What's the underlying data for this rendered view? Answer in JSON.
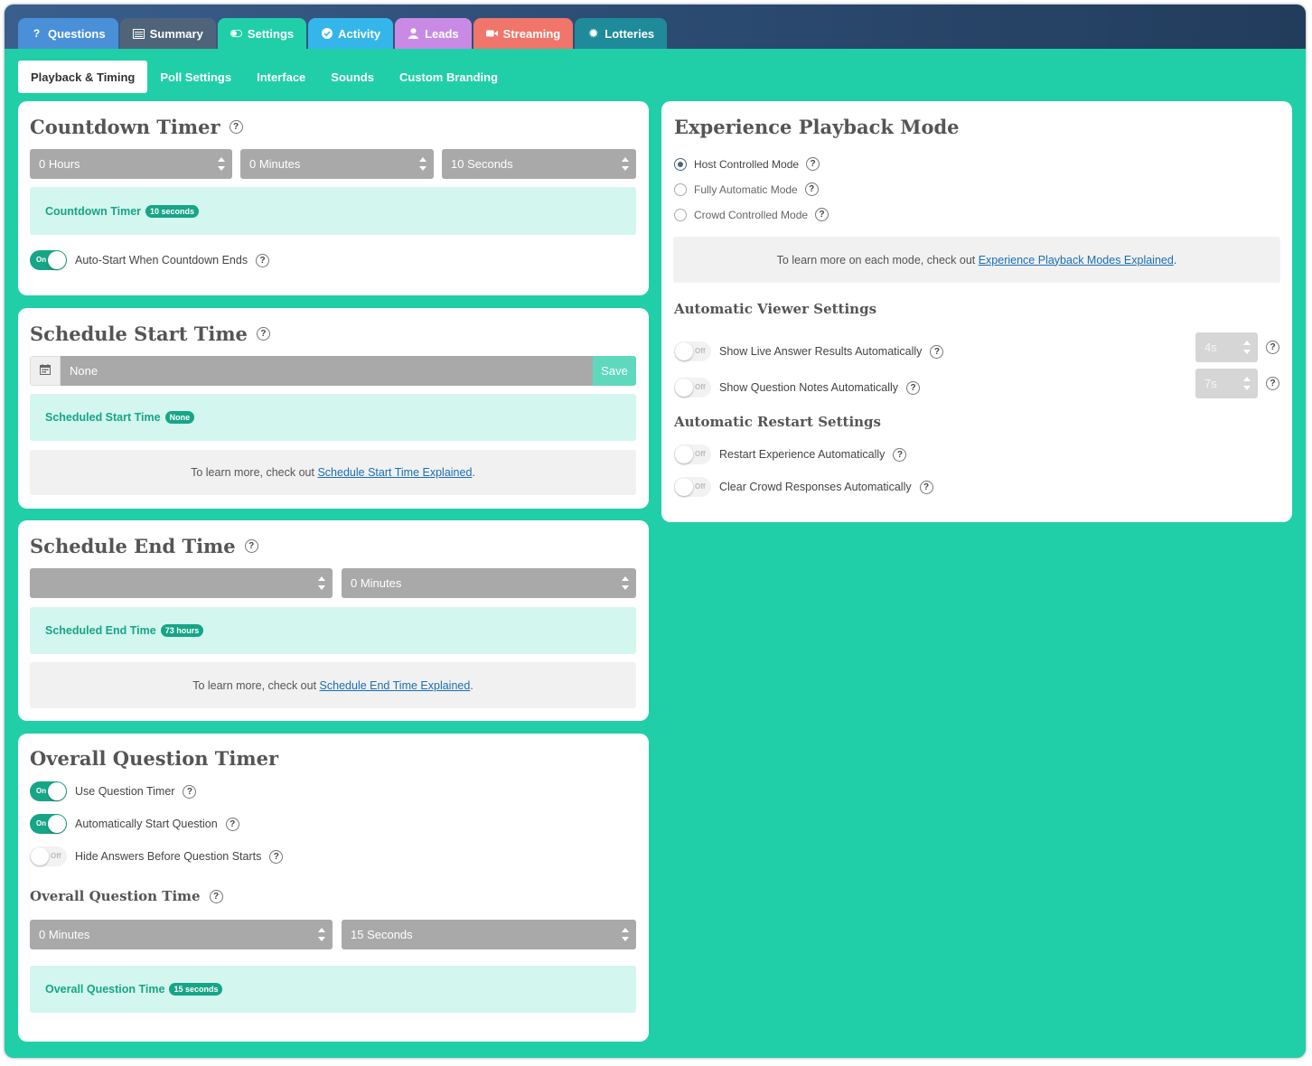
{
  "tabs": [
    {
      "label": "Questions",
      "icon": "question-icon",
      "color": "#4a90d9"
    },
    {
      "label": "Summary",
      "icon": "list-icon",
      "color": "#4f6479"
    },
    {
      "label": "Settings",
      "icon": "toggle-icon",
      "color": "#20cfa8"
    },
    {
      "label": "Activity",
      "icon": "check-circle-icon",
      "color": "#35b6ea"
    },
    {
      "label": "Leads",
      "icon": "user-icon",
      "color": "#c98ae6"
    },
    {
      "label": "Streaming",
      "icon": "video-icon",
      "color": "#f0756a"
    },
    {
      "label": "Lotteries",
      "icon": "gear-icon",
      "color": "#1f8b9a"
    }
  ],
  "subnav": [
    "Playback & Timing",
    "Poll Settings",
    "Interface",
    "Sounds",
    "Custom Branding"
  ],
  "countdown": {
    "title": "Countdown Timer",
    "hours": "0 Hours",
    "minutes": "0 Minutes",
    "seconds": "10 Seconds",
    "summary_label": "Countdown Timer",
    "summary_value": "10 seconds",
    "autostart_label": "Auto-Start When Countdown Ends",
    "autostart_state": "On"
  },
  "schedule_start": {
    "title": "Schedule Start Time",
    "date_value": "None",
    "save_label": "Save",
    "summary_label": "Scheduled Start Time",
    "summary_value": "None",
    "info_prefix": "To learn more, check out ",
    "info_link": "Schedule Start Time Explained",
    "info_suffix": "."
  },
  "schedule_end": {
    "title": "Schedule End Time",
    "hours": "",
    "minutes": "0 Minutes",
    "summary_label": "Scheduled End Time",
    "summary_value": "73 hours",
    "info_prefix": "To learn more, check out ",
    "info_link": "Schedule End Time Explained",
    "info_suffix": "."
  },
  "question_timer": {
    "title": "Overall Question Timer",
    "toggles": [
      {
        "label": "Use Question Timer",
        "state": "On"
      },
      {
        "label": "Automatically Start Question",
        "state": "On"
      },
      {
        "label": "Hide Answers Before Question Starts",
        "state": "Off"
      }
    ],
    "time_title": "Overall Question Time",
    "minutes": "0 Minutes",
    "seconds": "15 Seconds",
    "summary_label": "Overall Question Time",
    "summary_value": "15 seconds"
  },
  "playback": {
    "title": "Experience Playback Mode",
    "modes": [
      {
        "label": "Host Controlled Mode",
        "checked": true
      },
      {
        "label": "Fully Automatic Mode",
        "checked": false
      },
      {
        "label": "Crowd Controlled Mode",
        "checked": false
      }
    ],
    "info_prefix": "To learn more on each mode, check out ",
    "info_link": "Experience Playback Modes Explained",
    "info_suffix": ".",
    "viewer_title": "Automatic Viewer Settings",
    "viewer": [
      {
        "label": "Show Live Answer Results Automatically",
        "state": "Off",
        "select": "4s"
      },
      {
        "label": "Show Question Notes Automatically",
        "state": "Off",
        "select": "7s"
      }
    ],
    "restart_title": "Automatic Restart Settings",
    "restart": [
      {
        "label": "Restart Experience Automatically",
        "state": "Off"
      },
      {
        "label": "Clear Crowd Responses Automatically",
        "state": "Off"
      }
    ]
  },
  "help_glyph": "?"
}
